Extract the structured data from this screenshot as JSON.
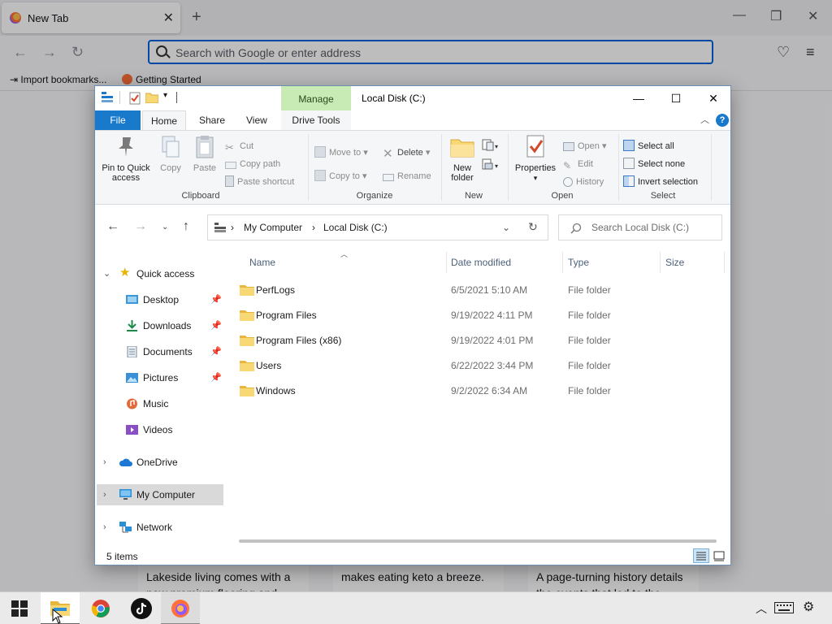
{
  "browser": {
    "tab_title": "New Tab",
    "url_placeholder": "Search with Google or enter address",
    "bookmarks": [
      "Import bookmarks...",
      "Getting Started"
    ],
    "cards": [
      "Lakeside living comes with a new premium flooring and",
      "makes eating keto a breeze.",
      "A page-turning history details the events that led to the"
    ]
  },
  "explorer": {
    "title": "Local Disk (C:)",
    "context_tab": "Manage",
    "ribbon_tabs": [
      "File",
      "Home",
      "Share",
      "View",
      "Drive Tools"
    ],
    "help": "?",
    "ribbon": {
      "clipboard": {
        "label": "Clipboard",
        "pin": "Pin to Quick access",
        "copy": "Copy",
        "paste": "Paste",
        "cut": "Cut",
        "copy_path": "Copy path",
        "paste_shortcut": "Paste shortcut"
      },
      "organize": {
        "label": "Organize",
        "move_to": "Move to",
        "copy_to": "Copy to",
        "delete": "Delete",
        "rename": "Rename"
      },
      "new": {
        "label": "New",
        "new_folder": "New folder"
      },
      "open": {
        "label": "Open",
        "properties": "Properties",
        "open": "Open",
        "edit": "Edit",
        "history": "History"
      },
      "select": {
        "label": "Select",
        "select_all": "Select all",
        "select_none": "Select none",
        "invert": "Invert selection"
      }
    },
    "breadcrumb": [
      "My Computer",
      "Local Disk (C:)"
    ],
    "search_placeholder": "Search Local Disk (C:)",
    "nav": {
      "quick_access": "Quick access",
      "pinned": [
        "Desktop",
        "Downloads",
        "Documents",
        "Pictures"
      ],
      "unpinned": [
        "Music",
        "Videos"
      ],
      "onedrive": "OneDrive",
      "my_computer": "My Computer",
      "network": "Network"
    },
    "columns": [
      "Name",
      "Date modified",
      "Type",
      "Size"
    ],
    "files": [
      {
        "name": "PerfLogs",
        "date": "6/5/2021 5:10 AM",
        "type": "File folder"
      },
      {
        "name": "Program Files",
        "date": "9/19/2022 4:11 PM",
        "type": "File folder"
      },
      {
        "name": "Program Files (x86)",
        "date": "9/19/2022 4:01 PM",
        "type": "File folder"
      },
      {
        "name": "Users",
        "date": "6/22/2022 3:44 PM",
        "type": "File folder"
      },
      {
        "name": "Windows",
        "date": "9/2/2022 6:34 AM",
        "type": "File folder"
      }
    ],
    "status": "5 items"
  },
  "taskbar": {
    "apps": [
      "start-icon",
      "file-explorer-icon",
      "chrome-icon",
      "tiktok-icon",
      "firefox-icon"
    ]
  },
  "colors": {
    "accent": "#1979ca",
    "manage_tab": "#c8ebb6",
    "folder": "#f8d775",
    "selected": "#d9d9d9"
  }
}
